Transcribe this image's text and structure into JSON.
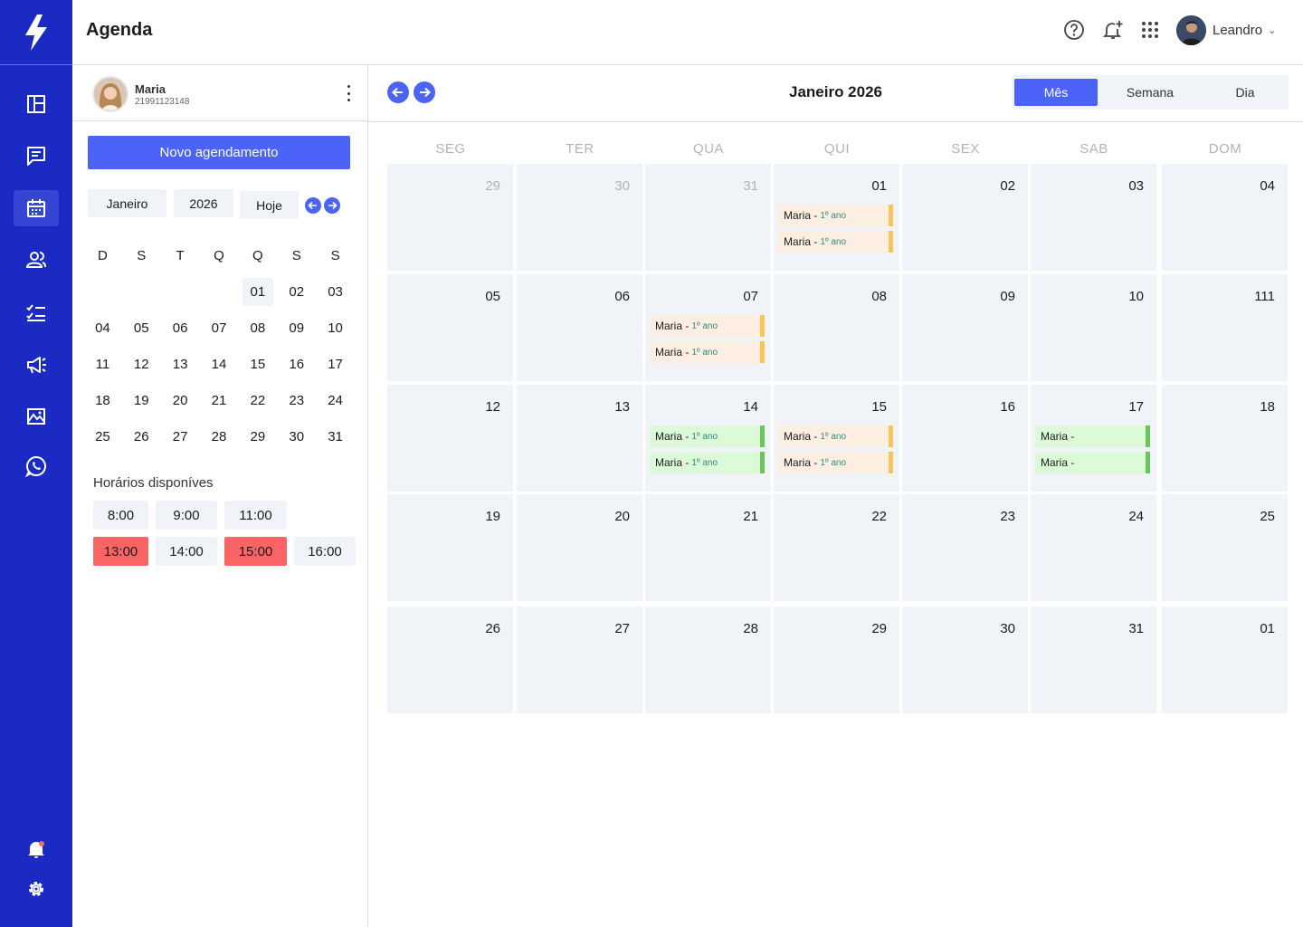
{
  "app": {
    "title": "Agenda"
  },
  "topbar": {
    "icons": [
      "help-icon",
      "notification-add-icon",
      "apps-grid-icon"
    ],
    "user_name": "Leandro"
  },
  "rail": {
    "items": [
      "dashboard-icon",
      "messages-icon",
      "calendar-icon",
      "contacts-icon",
      "tasks-icon",
      "campaigns-icon",
      "reports-icon",
      "whatsapp-icon"
    ],
    "active": "calendar-icon",
    "bottom": [
      "bell-icon",
      "settings-icon"
    ]
  },
  "profile": {
    "name": "Maria",
    "phone": "21991123148"
  },
  "side": {
    "new_button": "Novo agendamento",
    "month_chip": "Janeiro",
    "year_chip": "2026",
    "today_chip": "Hoje",
    "weekday_heads": [
      "D",
      "S",
      "T",
      "Q",
      "Q",
      "S",
      "S"
    ],
    "weeks": [
      [
        "",
        "",
        "",
        "",
        "01",
        "02",
        "03"
      ],
      [
        "04",
        "05",
        "06",
        "07",
        "08",
        "09",
        "10"
      ],
      [
        "11",
        "12",
        "13",
        "14",
        "15",
        "16",
        "17"
      ],
      [
        "18",
        "19",
        "20",
        "21",
        "22",
        "23",
        "24"
      ],
      [
        "25",
        "26",
        "27",
        "28",
        "29",
        "30",
        "31"
      ]
    ],
    "avail_title": "Horários disponíves",
    "slots": [
      {
        "time": "8:00",
        "busy": false
      },
      {
        "time": "9:00",
        "busy": false
      },
      {
        "time": "11:00",
        "busy": false
      },
      {
        "time": "13:00",
        "busy": true
      },
      {
        "time": "14:00",
        "busy": false
      },
      {
        "time": "15:00",
        "busy": true
      },
      {
        "time": "16:00",
        "busy": false
      }
    ]
  },
  "calendar": {
    "title": "Janeiro 2026",
    "views": [
      "Mês",
      "Semana",
      "Dia"
    ],
    "active_view": "Mês",
    "dow": [
      "SEG",
      "TER",
      "QUA",
      "QUI",
      "SEX",
      "SAB",
      "DOM"
    ],
    "weeks": [
      [
        "29",
        "30",
        "31",
        "01",
        "02",
        "03",
        "04"
      ],
      [
        "05",
        "06",
        "07",
        "08",
        "09",
        "10",
        "111"
      ],
      [
        "12",
        "13",
        "14",
        "15",
        "16",
        "17",
        "18"
      ],
      [
        "19",
        "20",
        "21",
        "22",
        "23",
        "24",
        "25"
      ],
      [
        "26",
        "27",
        "28",
        "29",
        "30",
        "31",
        "01"
      ]
    ],
    "muted": [
      [
        0,
        0
      ],
      [
        0,
        1
      ],
      [
        0,
        2
      ]
    ],
    "events": [
      {
        "week": 0,
        "day": 3,
        "name": "Maria -",
        "sub": "1º ano",
        "color": "orange"
      },
      {
        "week": 0,
        "day": 3,
        "name": "Maria -",
        "sub": "1º ano",
        "color": "orange"
      },
      {
        "week": 1,
        "day": 2,
        "name": "Maria -",
        "sub": "1º ano",
        "color": "orange"
      },
      {
        "week": 1,
        "day": 2,
        "name": "Maria -",
        "sub": "1º ano",
        "color": "orange"
      },
      {
        "week": 2,
        "day": 2,
        "name": "Maria -",
        "sub": "1º ano",
        "color": "green"
      },
      {
        "week": 2,
        "day": 2,
        "name": "Maria -",
        "sub": "1º ano",
        "color": "green"
      },
      {
        "week": 2,
        "day": 3,
        "name": "Maria -",
        "sub": "1º ano",
        "color": "orange"
      },
      {
        "week": 2,
        "day": 3,
        "name": "Maria -",
        "sub": "1º ano",
        "color": "orange"
      },
      {
        "week": 2,
        "day": 5,
        "name": "Maria -",
        "sub": "",
        "color": "green"
      },
      {
        "week": 2,
        "day": 5,
        "name": "Maria -",
        "sub": "",
        "color": "green"
      }
    ]
  },
  "colors": {
    "rail": "#1b2ac2",
    "accent": "#4c63f7",
    "busy_slot": "#f96464",
    "event_orange": "#fcefe2",
    "event_green": "#ddfad8",
    "cell_bg": "#f0f4f8"
  }
}
